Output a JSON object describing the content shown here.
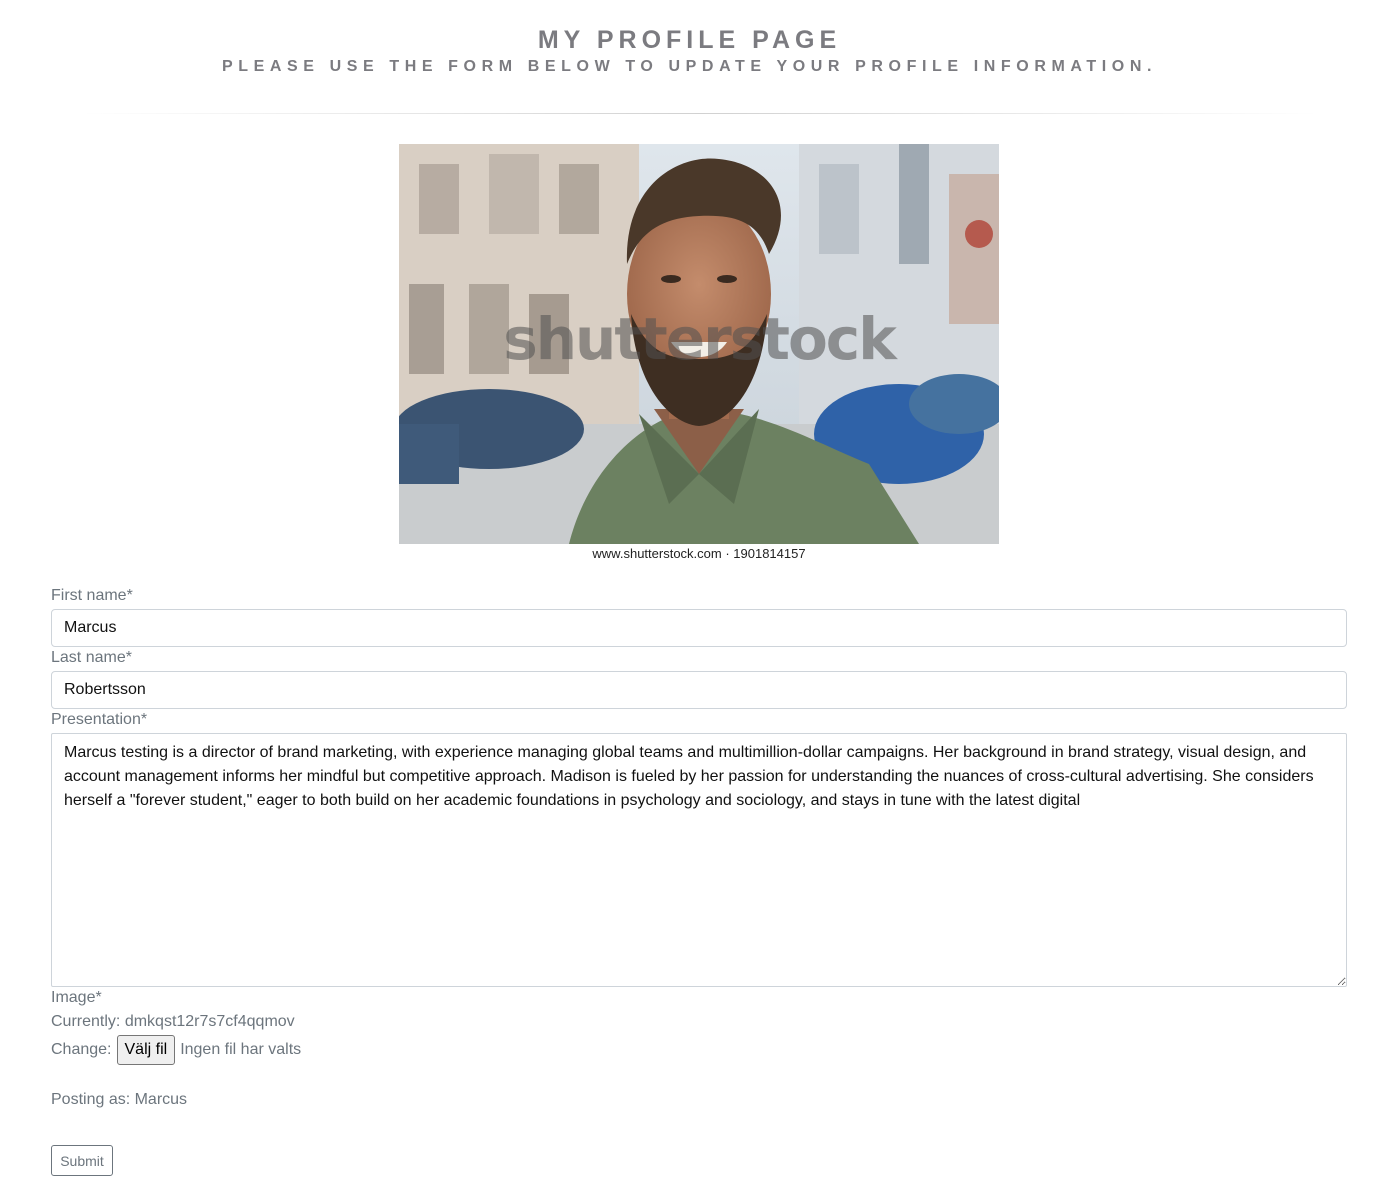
{
  "header": {
    "title": "MY PROFILE PAGE",
    "subtitle": "PLEASE USE THE FORM BELOW TO UPDATE YOUR PROFILE INFORMATION."
  },
  "profile_image": {
    "watermark": "shutterstock",
    "caption": "www.shutterstock.com · 1901814157"
  },
  "form": {
    "first_name_label": "First name*",
    "first_name_value": "Marcus",
    "last_name_label": "Last name*",
    "last_name_value": "Robertsson",
    "presentation_label": "Presentation*",
    "presentation_value": "Marcus testing is a director of brand marketing, with experience managing global teams and multimillion-dollar campaigns. Her background in brand strategy, visual design, and account management informs her mindful but competitive approach. Madison is fueled by her passion for understanding the nuances of cross-cultural advertising. She considers herself a \"forever student,\" eager to both build on her academic foundations in psychology and sociology, and stays in tune with the latest digital",
    "image_label": "Image*",
    "currently_label": "Currently:",
    "currently_value": "dmkqst12r7s7cf4qqmov",
    "change_label": "Change:",
    "choose_file_button": "Välj fil",
    "no_file_text": "Ingen fil har valts",
    "posting_as": "Posting as: Marcus",
    "submit_label": "Submit"
  }
}
